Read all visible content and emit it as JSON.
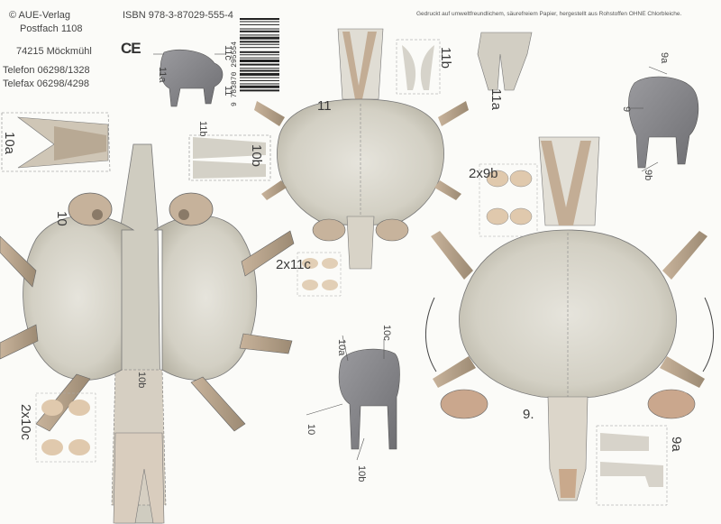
{
  "publisher": {
    "name": "© AUE-Verlag",
    "postbox": "Postfach 1108",
    "city": "74215 Möckmühl",
    "phone": "Telefon 06298/1328",
    "fax": "Telefax 06298/4298",
    "ce_mark": "CE"
  },
  "isbn": "ISBN 978-3-87029-555-4",
  "barcode_number": "9 783870 295554",
  "paper_note": "Gedruckt auf umweltfreundlichem, säurefreiem Papier, hergestellt aus Rohstoffen OHNE Chlorbleiche.",
  "part_labels": {
    "p11c": "11c",
    "p11a": "11a",
    "p11": "11",
    "p11b_small": "11b",
    "p11_body": "11",
    "p11b": "11b",
    "p11a_right": "11a",
    "p9a": "9a",
    "p9": "9",
    "p9b": "9b",
    "p10a": "10a",
    "p10b": "10b",
    "p10": "10",
    "p2x9b": "2x9b",
    "p2x11c": "2x11c",
    "p10a_small": "10a",
    "p10c": "10c",
    "p10_small": "10",
    "p10b_small": "10b",
    "p2x10c": "2x10c",
    "p9_body": "9.",
    "p9a_bottom": "9a",
    "p10b_bottom": "10b"
  },
  "colors": {
    "paper": "#fbfbf8",
    "wool": "#d9d7cc",
    "wool_shade": "#b9b5a6",
    "skin": "#c9b49d",
    "legs": "#a7937a",
    "grey_animal": "#8a8a8e",
    "cut_line": "#6a6a6a"
  }
}
